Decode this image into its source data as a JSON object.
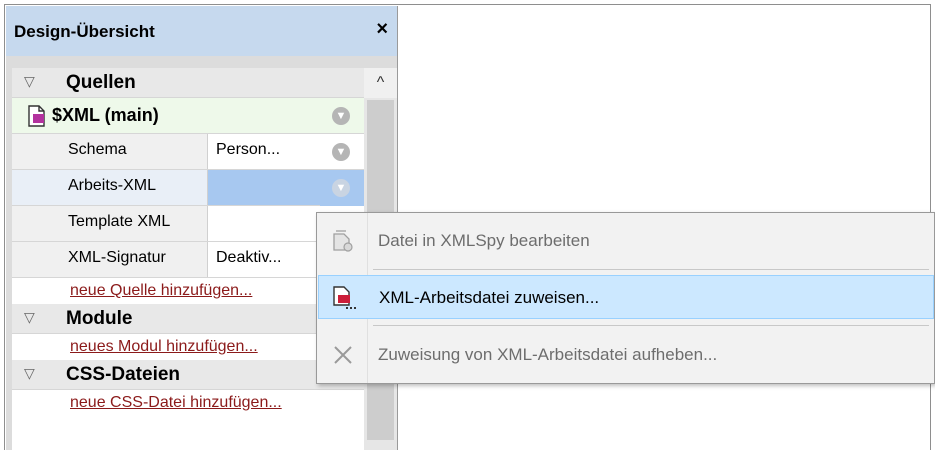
{
  "panel": {
    "title": "Design-Übersicht",
    "close_glyph": "×",
    "scroll_up_glyph": "^"
  },
  "groups": {
    "quellen": "Quellen",
    "module": "Module",
    "css": "CSS-Dateien"
  },
  "source": {
    "name": "$XML (main)",
    "icon": "xml-document-icon"
  },
  "properties": [
    {
      "label": "Schema",
      "value": "Person..."
    },
    {
      "label": "Arbeits-XML",
      "value": ""
    },
    {
      "label": "Template XML",
      "value": ""
    },
    {
      "label": "XML-Signatur",
      "value": "Deaktiv..."
    }
  ],
  "links": {
    "add_source": "neue Quelle hinzufügen...",
    "add_module": "neues Modul hinzufügen...",
    "add_css": "neue CSS-Datei hinzufügen..."
  },
  "context_menu": {
    "items": [
      {
        "label": "Datei in XMLSpy bearbeiten",
        "enabled": false,
        "icon": "edit-in-xmlspy-icon"
      },
      {
        "label": "XML-Arbeitsdatei zuweisen...",
        "enabled": true,
        "highlighted": true,
        "icon": "assign-working-xml-icon"
      },
      {
        "label": "Zuweisung von XML-Arbeitsdatei aufheben...",
        "enabled": false,
        "icon": "remove-assignment-icon"
      }
    ]
  },
  "colors": {
    "title_bar": "#c6d9ee",
    "source_row": "#eef9ea",
    "selected_value": "#a7c8f0",
    "link": "#8b1a1a",
    "menu_highlight": "#cce8ff"
  }
}
